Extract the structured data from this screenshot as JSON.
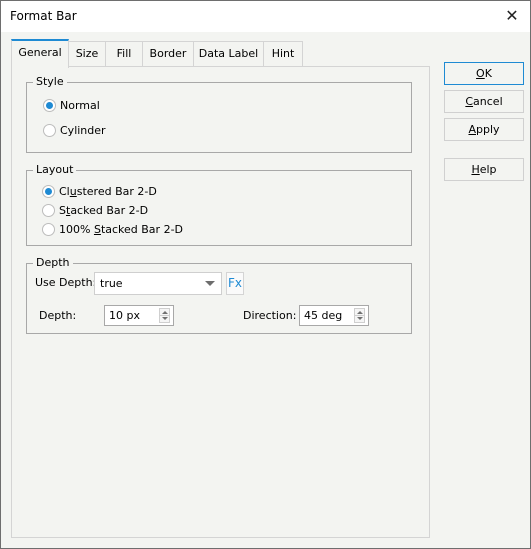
{
  "window": {
    "title": "Format Bar",
    "close_icon": "close-icon"
  },
  "tabs": [
    {
      "label": "General",
      "active": true
    },
    {
      "label": "Size",
      "active": false
    },
    {
      "label": "Fill",
      "active": false
    },
    {
      "label": "Border",
      "active": false
    },
    {
      "label": "Data Label",
      "active": false
    },
    {
      "label": "Hint",
      "active": false
    }
  ],
  "style_group": {
    "label": "Style",
    "options": [
      {
        "label": "Normal",
        "checked": true
      },
      {
        "label": "Cylinder",
        "checked": false
      }
    ]
  },
  "layout_group": {
    "label": "Layout",
    "options": [
      {
        "pre": "Cl",
        "mnemonic": "u",
        "post": "stered Bar 2-D",
        "checked": true
      },
      {
        "pre": "S",
        "mnemonic": "t",
        "post": "acked Bar 2-D",
        "checked": false
      },
      {
        "pre": "100% ",
        "mnemonic": "S",
        "post": "tacked Bar 2-D",
        "checked": false
      }
    ]
  },
  "depth_group": {
    "label": "Depth",
    "use_depth_label": "Use Depth:",
    "use_depth_value": "true",
    "fx_label": "Fx",
    "depth_label": "Depth:",
    "depth_value": "10 px",
    "direction_label": "Direction:",
    "direction_value": "45 deg"
  },
  "buttons": {
    "ok": {
      "mnemonic": "O",
      "rest": "K"
    },
    "cancel": {
      "mnemonic": "C",
      "rest": "ancel"
    },
    "apply": {
      "mnemonic": "A",
      "rest": "pply"
    },
    "help": {
      "mnemonic": "H",
      "rest": "elp"
    }
  },
  "colors": {
    "accent": "#1e8ad3",
    "background": "#f3f4f1"
  }
}
